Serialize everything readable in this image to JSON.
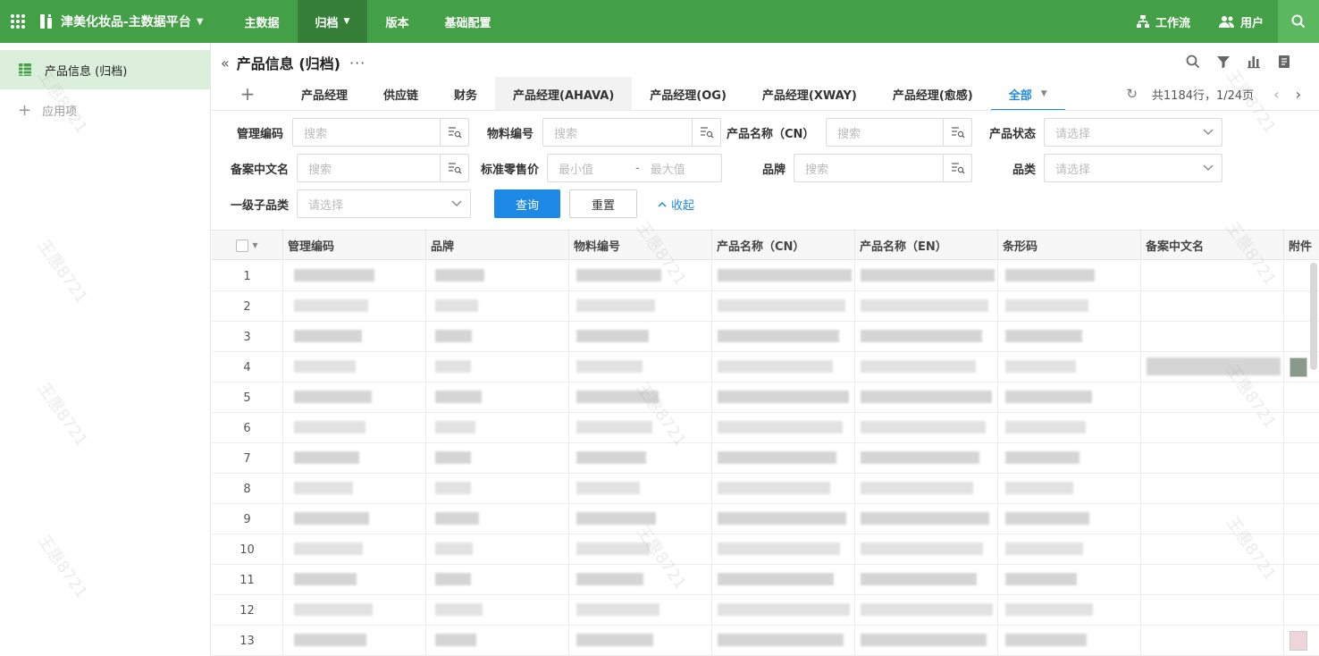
{
  "topbar": {
    "app_title": "津美化妆品-主数据平台",
    "nav": [
      "主数据",
      "归档",
      "版本",
      "基础配置"
    ],
    "active_nav": "归档",
    "workflow": "工作流",
    "users": "用户",
    "brand_color": "#43a047"
  },
  "sidebar": {
    "active_item": "产品信息 (归档)",
    "add_item": "应用项"
  },
  "page": {
    "title": "产品信息 (归档)",
    "more": "···"
  },
  "tabs": {
    "items": [
      "产品经理",
      "供应链",
      "财务",
      "产品经理(AHAVA)",
      "产品经理(OG)",
      "产品经理(XWAY)",
      "产品经理(愈感)",
      "全部"
    ],
    "selected": "全部",
    "summary": "共1184行，1/24页"
  },
  "filters": {
    "mgmt_code": {
      "label": "管理编码",
      "placeholder": "搜索"
    },
    "material_no": {
      "label": "物料编号",
      "placeholder": "搜索"
    },
    "name_cn": {
      "label": "产品名称（CN）",
      "placeholder": "搜索"
    },
    "status": {
      "label": "产品状态",
      "placeholder": "请选择"
    },
    "record_name": {
      "label": "备案中文名",
      "placeholder": "搜索"
    },
    "retail_price": {
      "label": "标准零售价",
      "min": "最小值",
      "dash": "-",
      "max": "最大值"
    },
    "brand": {
      "label": "品牌",
      "placeholder": "搜索"
    },
    "category": {
      "label": "品类",
      "placeholder": "请选择"
    },
    "sub_category": {
      "label": "一级子品类",
      "placeholder": "请选择"
    },
    "query_btn": "查询",
    "reset_btn": "重置",
    "collapse": "收起"
  },
  "table": {
    "columns": [
      "管理编码",
      "品牌",
      "物料编号",
      "产品名称（CN）",
      "产品名称（EN）",
      "条形码",
      "备案中文名",
      "附件"
    ],
    "rows": [
      "1",
      "2",
      "3",
      "4",
      "5",
      "6",
      "7",
      "8",
      "9",
      "10",
      "11",
      "12",
      "13"
    ]
  },
  "watermark": "王惠8721"
}
